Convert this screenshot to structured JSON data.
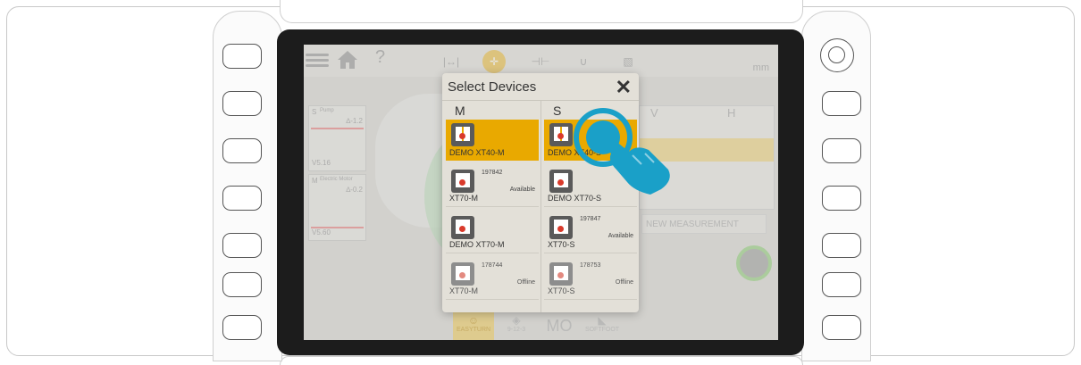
{
  "app": {
    "toolbar": {
      "help_symbol": "?",
      "unit": "mm",
      "icons": [
        "menu-icon",
        "home-icon",
        "help-icon",
        "distance-icon",
        "target-icon",
        "coupling-icon",
        "magnet-icon",
        "ruler-icon"
      ]
    },
    "sensor_s": {
      "label": "S",
      "sublabel": "Pump",
      "value": "∆-1.2",
      "version": "V5.16"
    },
    "sensor_m": {
      "label": "M",
      "sublabel": "Electric Motor",
      "value": "∆-0.2",
      "version": "V5.60"
    },
    "results_table": {
      "col_v": "V",
      "col_h": "H"
    },
    "new_measurement": "NEW MEASUREMENT",
    "bottom_bar": [
      {
        "label": "EASYTURN",
        "active": true
      },
      {
        "label": "9-12-3",
        "active": false
      },
      {
        "label": "MO",
        "active": false
      },
      {
        "label": "SOFTFOOT",
        "active": false
      }
    ]
  },
  "dialog": {
    "title": "Select Devices",
    "close_symbol": "✕",
    "column_m": "M",
    "column_s": "S",
    "m_devices": [
      {
        "name": "DEMO XT40-M",
        "serial": "",
        "status": "",
        "selected": true,
        "offline": false
      },
      {
        "name": "XT70-M",
        "serial": "197842",
        "status": "Available",
        "selected": false,
        "offline": false
      },
      {
        "name": "DEMO XT70-M",
        "serial": "",
        "status": "",
        "selected": false,
        "offline": false
      },
      {
        "name": "XT70-M",
        "serial": "178744",
        "status": "Offline",
        "selected": false,
        "offline": true
      }
    ],
    "s_devices": [
      {
        "name": "DEMO XT40-S",
        "serial": "",
        "status": "",
        "selected": true,
        "offline": false
      },
      {
        "name": "DEMO XT70-S",
        "serial": "",
        "status": "",
        "selected": false,
        "offline": false
      },
      {
        "name": "XT70-S",
        "serial": "197847",
        "status": "Available",
        "selected": false,
        "offline": false
      },
      {
        "name": "XT70-S",
        "serial": "178753",
        "status": "Offline",
        "selected": false,
        "offline": true
      }
    ]
  },
  "colors": {
    "accent": "#e9a900",
    "touch": "#1aa0c8",
    "dialog_bg": "#e3e0d8"
  }
}
